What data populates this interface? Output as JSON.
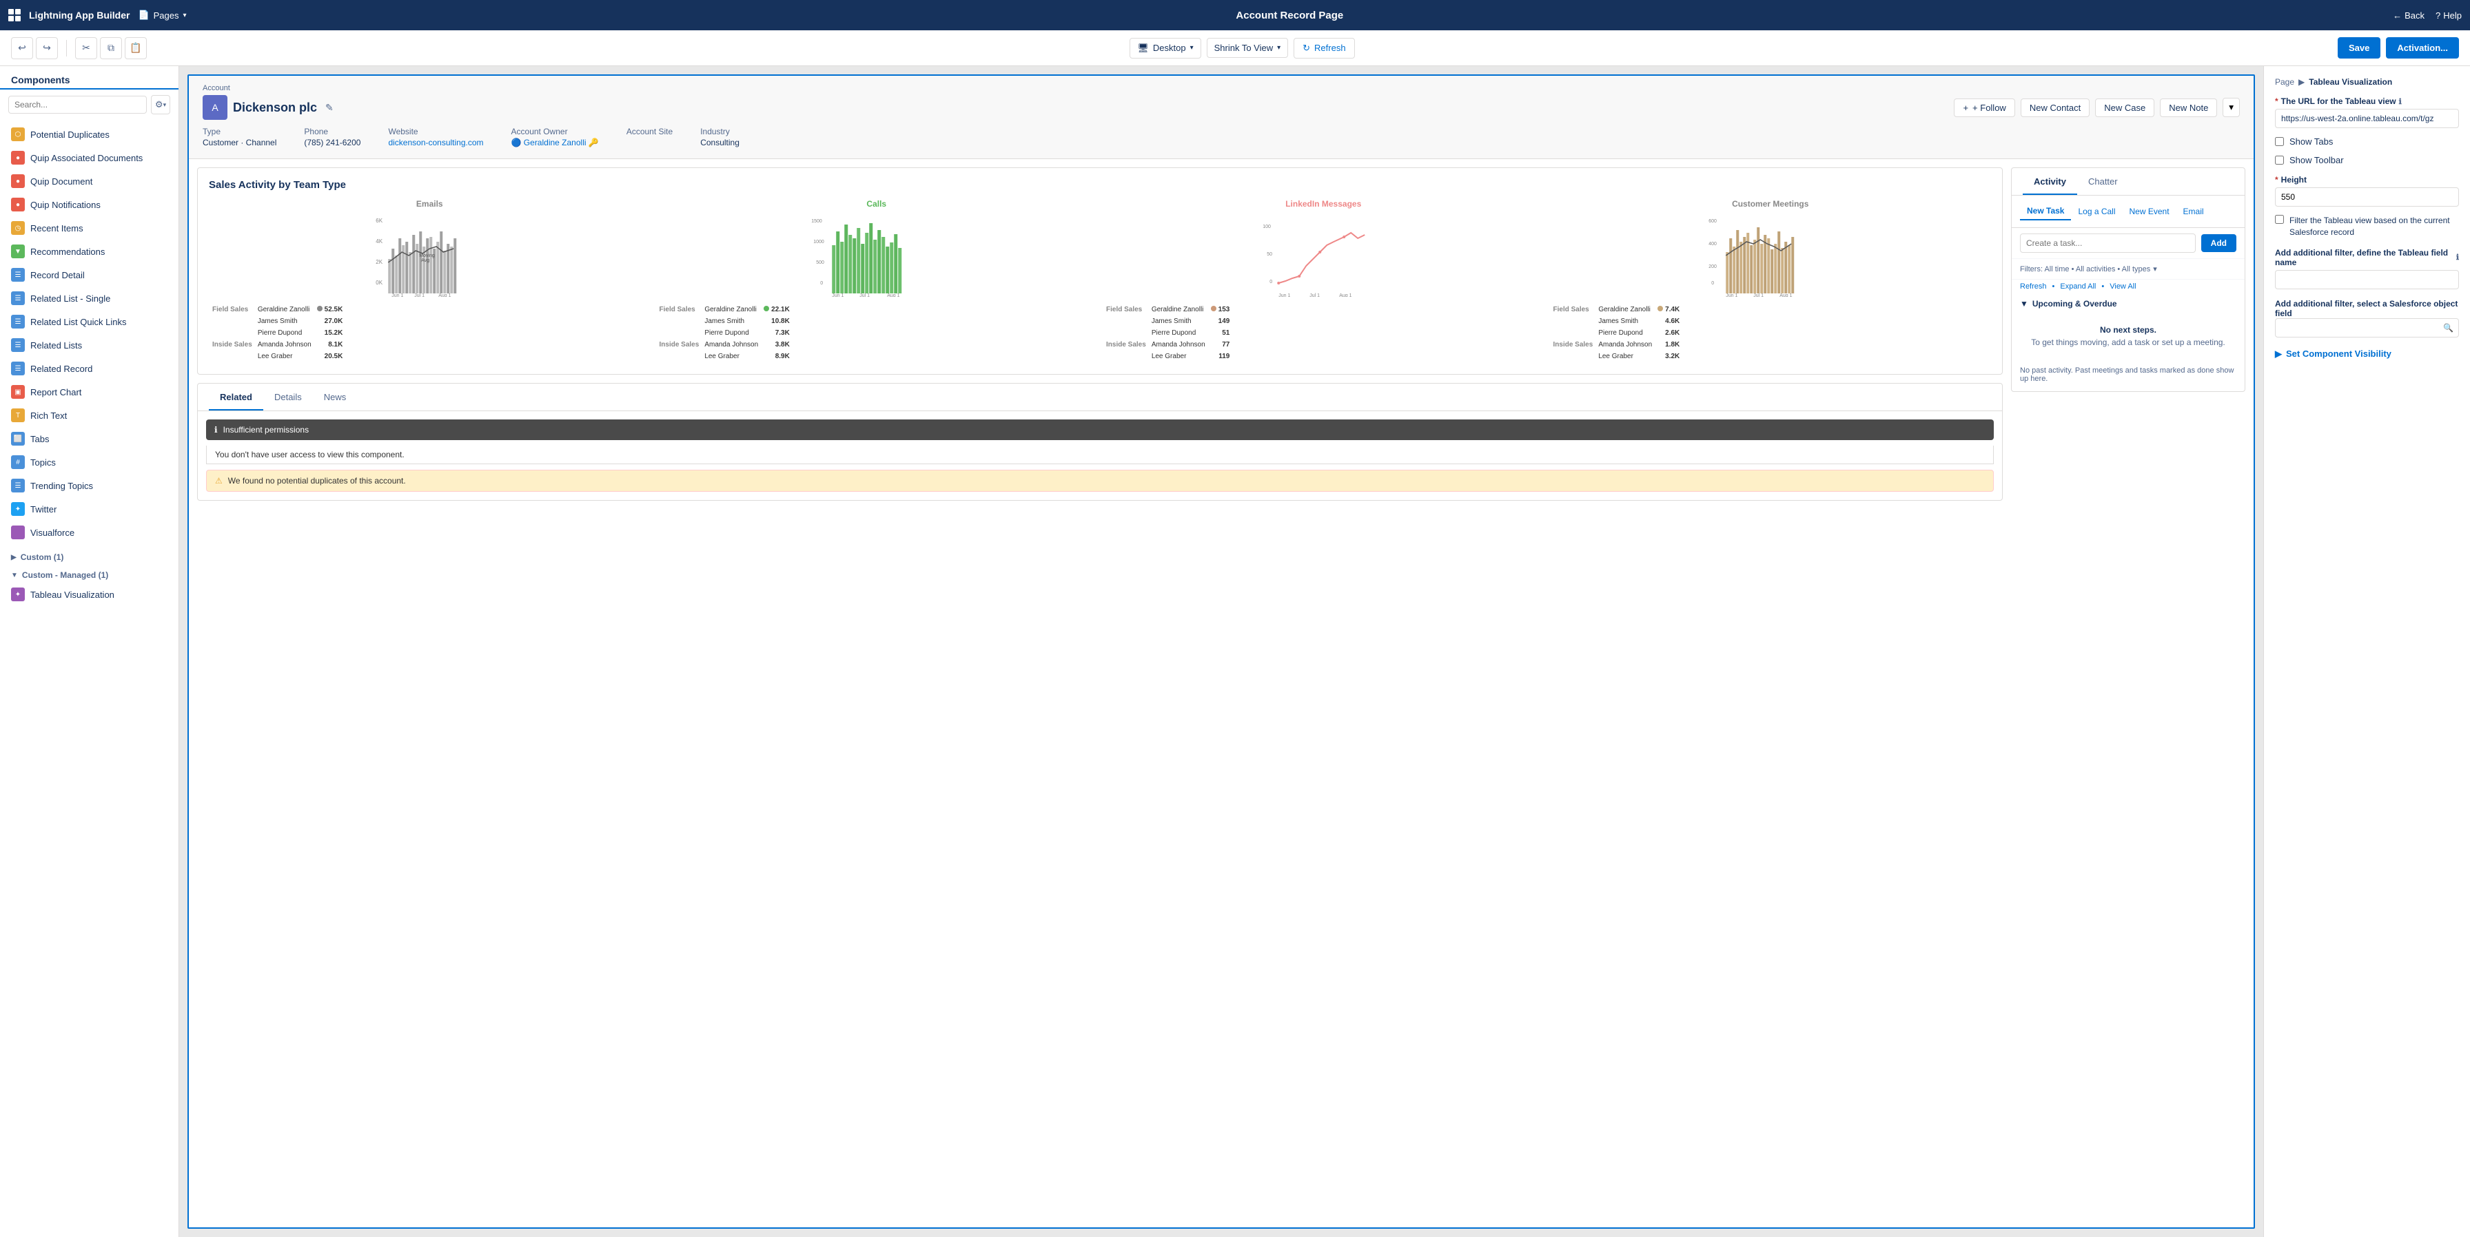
{
  "topNav": {
    "appName": "Lightning App Builder",
    "pagesLabel": "Pages",
    "pageTitle": "Account Record Page",
    "backLabel": "Back",
    "helpLabel": "Help"
  },
  "toolbar": {
    "deviceLabel": "Desktop",
    "viewLabel": "Shrink To View",
    "refreshLabel": "Refresh",
    "saveLabel": "Save",
    "activationLabel": "Activation..."
  },
  "sidebar": {
    "title": "Components",
    "searchPlaceholder": "Search...",
    "components": [
      {
        "id": "potential-duplicates",
        "label": "Potential Duplicates",
        "color": "#e8a838",
        "icon": "⬡"
      },
      {
        "id": "quip-associated",
        "label": "Quip Associated Documents",
        "color": "#e85c4a",
        "icon": "●"
      },
      {
        "id": "quip-document",
        "label": "Quip Document",
        "color": "#e85c4a",
        "icon": "●"
      },
      {
        "id": "quip-notifications",
        "label": "Quip Notifications",
        "color": "#e85c4a",
        "icon": "●"
      },
      {
        "id": "recent-items",
        "label": "Recent Items",
        "color": "#e8a838",
        "icon": "◷"
      },
      {
        "id": "recommendations",
        "label": "Recommendations",
        "color": "#5cb85c",
        "icon": "▼"
      },
      {
        "id": "record-detail",
        "label": "Record Detail",
        "color": "#4a90d9",
        "icon": "☰"
      },
      {
        "id": "related-list-single",
        "label": "Related List - Single",
        "color": "#4a90d9",
        "icon": "☰"
      },
      {
        "id": "related-list-quick",
        "label": "Related List Quick Links",
        "color": "#4a90d9",
        "icon": "☰"
      },
      {
        "id": "related-lists",
        "label": "Related Lists",
        "color": "#4a90d9",
        "icon": "☰"
      },
      {
        "id": "related-record",
        "label": "Related Record",
        "color": "#4a90d9",
        "icon": "☰"
      },
      {
        "id": "report-chart",
        "label": "Report Chart",
        "color": "#e85c4a",
        "icon": "▣"
      },
      {
        "id": "rich-text",
        "label": "Rich Text",
        "color": "#e8a838",
        "icon": "T"
      },
      {
        "id": "tabs",
        "label": "Tabs",
        "color": "#4a90d9",
        "icon": "⬜"
      },
      {
        "id": "topics",
        "label": "Topics",
        "color": "#4a90d9",
        "icon": "#"
      },
      {
        "id": "trending-topics",
        "label": "Trending Topics",
        "color": "#4a90d9",
        "icon": "☰"
      },
      {
        "id": "twitter",
        "label": "Twitter",
        "color": "#1da1f2",
        "icon": "✦"
      },
      {
        "id": "visualforce",
        "label": "Visualforce",
        "color": "#9b59b6",
        "icon": "</>"
      }
    ],
    "customSection": "Custom (1)",
    "customManagedSection": "Custom - Managed (1)",
    "tableauVisualization": "Tableau Visualization"
  },
  "account": {
    "breadcrumb": "Account",
    "name": "Dickenson plc",
    "editIcon": "✎",
    "followLabel": "+ Follow",
    "newContactLabel": "New Contact",
    "newCaseLabel": "New Case",
    "newNoteLabel": "New Note",
    "meta": [
      {
        "label": "Type",
        "value": "Customer · Channel"
      },
      {
        "label": "Phone",
        "value": "(785) 241-6200"
      },
      {
        "label": "Website",
        "value": "dickenson-consulting.com",
        "link": true
      },
      {
        "label": "Account Owner",
        "value": "Geraldine Zanolli",
        "icon": true
      },
      {
        "label": "Account Site",
        "value": ""
      },
      {
        "label": "Industry",
        "value": "Consulting"
      }
    ]
  },
  "chart": {
    "title": "Sales Activity by Team Type",
    "columns": [
      {
        "id": "emails",
        "label": "Emails",
        "color": "#888"
      },
      {
        "id": "calls",
        "label": "Calls",
        "color": "#5cb85c"
      },
      {
        "id": "linkedin",
        "label": "LinkedIn Messages",
        "color": "#e88"
      },
      {
        "id": "meetings",
        "label": "Customer Meetings",
        "color": "#888"
      }
    ],
    "yLabels": {
      "emails": [
        "6K",
        "4K",
        "2K",
        "0K"
      ],
      "calls": [
        "1500",
        "1000",
        "500",
        "0"
      ],
      "linkedin": [
        "100",
        "50",
        "0"
      ],
      "meetings": [
        "600",
        "400",
        "200",
        "0"
      ]
    },
    "xLabels": [
      "Jun 1",
      "Jul 1",
      "Aug 1"
    ],
    "tableData": {
      "emails": [
        {
          "team": "Field Sales",
          "person": "Geraldine Zanolli",
          "value": "52.5K"
        },
        {
          "team": "",
          "person": "James Smith",
          "value": "27.0K"
        },
        {
          "team": "",
          "person": "Pierre Dupond",
          "value": "15.2K"
        },
        {
          "team": "Inside Sales",
          "person": "Amanda Johnson",
          "value": "8.1K"
        },
        {
          "team": "",
          "person": "Lee Graber",
          "value": "20.5K"
        }
      ],
      "calls": [
        {
          "team": "Field Sales",
          "person": "Geraldine Zanolli",
          "value": "22.1K"
        },
        {
          "team": "",
          "person": "James Smith",
          "value": "10.8K"
        },
        {
          "team": "",
          "person": "Pierre Dupond",
          "value": "7.3K"
        },
        {
          "team": "Inside Sales",
          "person": "Amanda Johnson",
          "value": "3.8K"
        },
        {
          "team": "",
          "person": "Lee Graber",
          "value": "8.9K"
        }
      ],
      "linkedin": [
        {
          "team": "Field Sales",
          "person": "Geraldine Zanolli",
          "value": "153"
        },
        {
          "team": "",
          "person": "James Smith",
          "value": "149"
        },
        {
          "team": "",
          "person": "Pierre Dupond",
          "value": "51"
        },
        {
          "team": "Inside Sales",
          "person": "Amanda Johnson",
          "value": "77"
        },
        {
          "team": "",
          "person": "Lee Graber",
          "value": "119"
        }
      ],
      "meetings": [
        {
          "team": "Field Sales",
          "person": "Geraldine Zanolli",
          "value": "7.4K"
        },
        {
          "team": "",
          "person": "James Smith",
          "value": "4.6K"
        },
        {
          "team": "",
          "person": "Pierre Dupond",
          "value": "2.6K"
        },
        {
          "team": "Inside Sales",
          "person": "Amanda Johnson",
          "value": "1.8K"
        },
        {
          "team": "",
          "person": "Lee Graber",
          "value": "3.2K"
        }
      ]
    },
    "movingAvgLabel": "Moving Avg"
  },
  "relatedTabs": [
    "Related",
    "Details",
    "News"
  ],
  "activeRelatedTab": "Related",
  "warnings": [
    {
      "type": "insufficient",
      "message": "Insufficient permissions",
      "detail": "You don't have user access to view this component."
    },
    {
      "type": "duplicates",
      "message": "We found no potential duplicates of this account."
    }
  ],
  "activity": {
    "tabs": [
      "Activity",
      "Chatter"
    ],
    "activeTab": "Activity",
    "actions": [
      "New Task",
      "Log a Call",
      "New Event",
      "Email"
    ],
    "taskPlaceholder": "Create a task...",
    "addLabel": "Add",
    "filtersLabel": "Filters: All time • All activities • All types",
    "filterArrow": "▾",
    "refreshLink": "Refresh",
    "expandAllLink": "Expand All",
    "viewAllLink": "View All",
    "upcomingLabel": "Upcoming & Overdue",
    "noNextSteps": "No next steps.",
    "noNextStepsDetail": "To get things moving, add a task or set up a meeting.",
    "noPastActivity": "No past activity. Past meetings and tasks marked as done show up here."
  },
  "rightPanel": {
    "pageBreadcrumb": "Page",
    "currentSection": "Tableau Visualization",
    "urlLabel": "The URL for the Tableau view",
    "urlValue": "https://us-west-2a.online.tableau.com/t/gz",
    "showTabsLabel": "Show Tabs",
    "showToolbarLabel": "Show Toolbar",
    "heightLabel": "Height",
    "heightValue": "550",
    "filterCheckboxLabel": "Filter the Tableau view based on the current Salesforce record",
    "additionalFilterNameLabel": "Add additional filter, define the Tableau field name",
    "additionalFilterObjectLabel": "Add additional filter, select a Salesforce object field",
    "setVisibilityLabel": "Set Component Visibility"
  }
}
